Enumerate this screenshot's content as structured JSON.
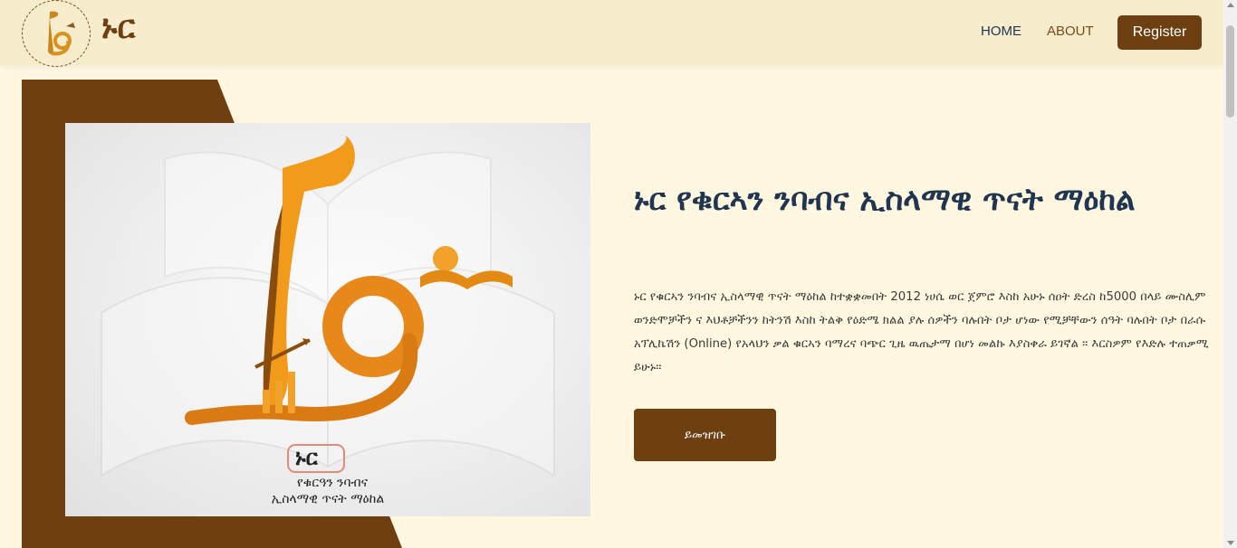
{
  "header": {
    "logo_text": "ኑር",
    "nav": {
      "home": "HOME",
      "about": "ABOUT"
    },
    "register_label": "Register"
  },
  "hero": {
    "title": "ኑር የቁርኣን ንባብና ኢስላማዊ ጥናት ማዕከል",
    "description": "ኑር የቁርኣን ንባብና ኢስላማዊ ጥናት ማዕከል ከተቋቋመበት 2012 ነሀሴ ወር ጀምሮ እስከ አሁኑ ሰዐት ድረስ ከ5000 በላይ ሙስሊም ወንድሞቻችን ና እህቶቻችንን ከትንሽ እስከ ትልቅ የዕድሜ ክልል ያሉ ሰዎችን ባሉበት ቦታ ሆነው የሚቻቸውን ሰዓት ባሉበት ቦታ በራሱ አፕሊኬሽን (Online) የአላህን ቃል ቁርኣን ባማረና ባጭር ጊዜ ዉጤታማ በሆነ መልኩ እያስቀራ ይገኛል ። እርስዎም የእድሉ ተጠቃሚ ይሁኑ።",
    "cta_label": "ይመዝገቡ",
    "image": {
      "brand_name": "ኑር",
      "subtitle_line1": "የቁርዓን ንባብና",
      "subtitle_line2": "ኢስላማዊ ጥናት ማዕከል"
    }
  },
  "colors": {
    "brand_brown": "#6e3f10",
    "heading_navy": "#1f3550",
    "page_bg": "#fff7e0",
    "header_bg": "#f7eccb",
    "logo_orange": "#f29a1a"
  }
}
